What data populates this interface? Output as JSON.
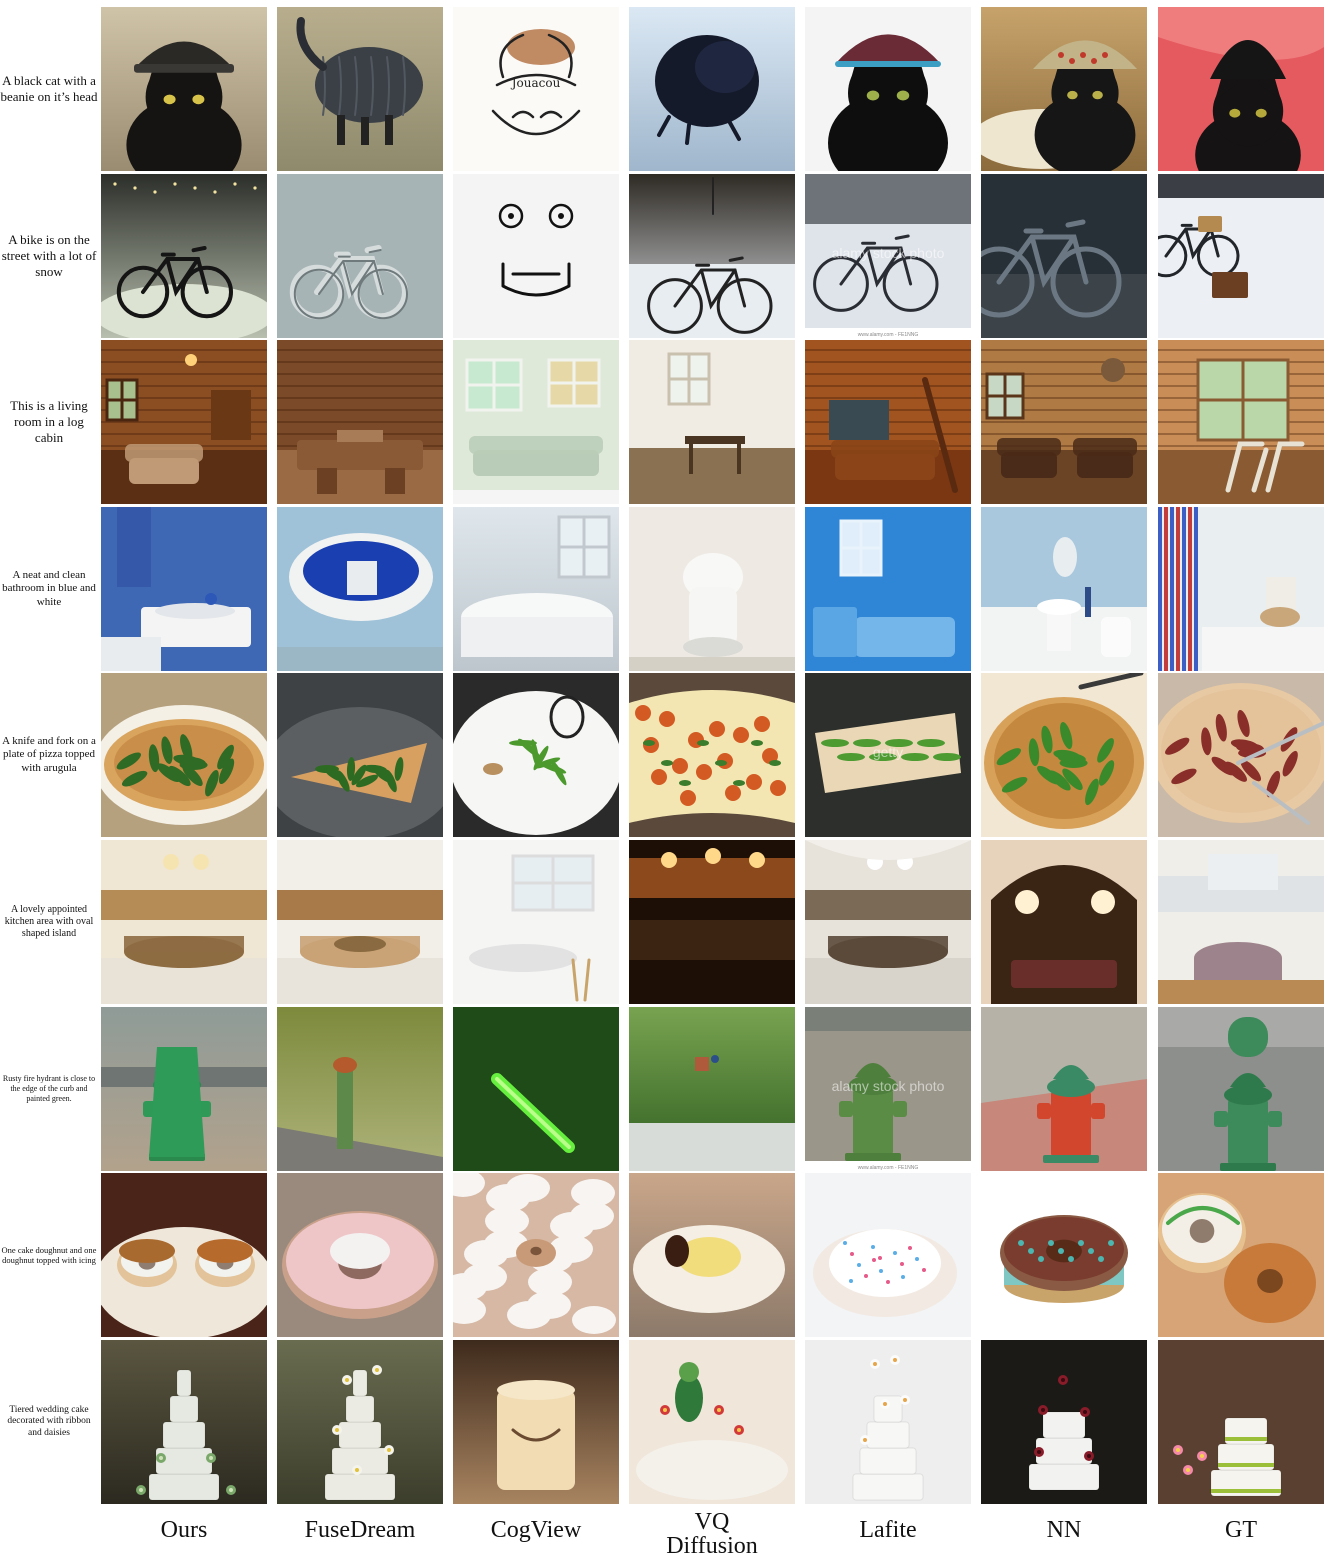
{
  "columns": [
    "Ours",
    "FuseDream",
    "CogView",
    "VQ Diffusion",
    "Lafite",
    "NN",
    "GT"
  ],
  "rows": [
    {
      "caption": "A black cat with a beanie on it’s head",
      "tiles": [
        "cat-beanie",
        "cat-knit-blob",
        "sketch-cat-face",
        "black-fur-closeup",
        "cat-dark-beanie",
        "cat-patterned-hat",
        "cat-red-blanket"
      ]
    },
    {
      "caption": "A bike is on the street with a lot of snow",
      "tiles": [
        "bike-snow-night",
        "bike-sketch-snow",
        "bike-doodle-face",
        "bike-snow-dark-street",
        "bike-snow-watermark",
        "bike-dark-parking",
        "bike-basket-snow"
      ]
    },
    {
      "caption": "This is a living room in a log cabin",
      "tiles": [
        "cabin-living-room",
        "cabin-wood-furniture",
        "pastel-living-room",
        "bright-dining-room",
        "cabin-orange-interior",
        "cabin-leather-sofas",
        "cabin-lounge-chairs"
      ]
    },
    {
      "caption": "A neat and clean bathroom in blue and white",
      "tiles": [
        "blue-bathroom-sink",
        "blue-bathtub",
        "white-bathtub",
        "white-toilet",
        "blue-bathroom-tub",
        "light-blue-bathroom",
        "bathroom-striped-curtain"
      ]
    },
    {
      "caption": "A knife and fork on a plate of pizza topped with arugula",
      "tiles": [
        "pizza-arugula",
        "pizza-slice-greens",
        "white-plate-greens",
        "pizza-tomato",
        "pizza-slices-watermark",
        "pizza-arugula-knife",
        "pizza-meat-knife"
      ]
    },
    {
      "caption": "A lovely appointed kitchen area with oval shaped island",
      "tiles": [
        "kitchen-oval-island",
        "kitchen-wood-island",
        "white-kitchen",
        "dark-kitchen",
        "kitchen-arch-ceiling",
        "kitchen-arch-lamps",
        "kitchen-round-island"
      ]
    },
    {
      "caption": "Rusty fire hydrant is close to the edge of the curb and painted green.",
      "tiles": [
        "green-hydrant",
        "hydrant-grass",
        "green-streak",
        "green-field",
        "hydrant-watermark",
        "red-hydrant",
        "green-hydrant-gt"
      ]
    },
    {
      "caption": "One cake doughnut and one doughnut topped with icing",
      "tiles": [
        "two-doughnuts-plate",
        "pink-doughnut",
        "white-icing-blur",
        "cream-dessert-blur",
        "iced-doughnut",
        "chocolate-doughnut",
        "iced-and-cake-doughnut"
      ]
    },
    {
      "caption": "Tiered wedding cake decorated with ribbon and daisies",
      "tiles": [
        "white-tiered-cake",
        "cake-daisies",
        "candle-cake",
        "cake-figurine",
        "cake-white-flowers",
        "cake-roses-dark",
        "cake-green-ribbon"
      ]
    }
  ],
  "palette": {
    "background": "#ffffff",
    "text": "#111111",
    "sky": "#cdd7e0",
    "snow": "#e8ecef",
    "wood": "#8a4e22",
    "bathroom_blue": "#3e68b4",
    "arugula": "#2f6b25",
    "crust": "#d9a45d",
    "hydrant_green": "#3d8a5b",
    "cake_white": "#f1efe8"
  }
}
